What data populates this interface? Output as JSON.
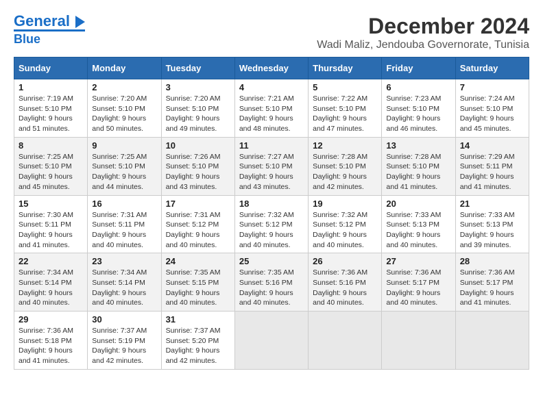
{
  "logo": {
    "text1": "General",
    "text2": "Blue"
  },
  "title": "December 2024",
  "subtitle": "Wadi Maliz, Jendouba Governorate, Tunisia",
  "days_header": [
    "Sunday",
    "Monday",
    "Tuesday",
    "Wednesday",
    "Thursday",
    "Friday",
    "Saturday"
  ],
  "weeks": [
    [
      {
        "day": "1",
        "sunrise": "Sunrise: 7:19 AM",
        "sunset": "Sunset: 5:10 PM",
        "daylight": "Daylight: 9 hours and 51 minutes."
      },
      {
        "day": "2",
        "sunrise": "Sunrise: 7:20 AM",
        "sunset": "Sunset: 5:10 PM",
        "daylight": "Daylight: 9 hours and 50 minutes."
      },
      {
        "day": "3",
        "sunrise": "Sunrise: 7:20 AM",
        "sunset": "Sunset: 5:10 PM",
        "daylight": "Daylight: 9 hours and 49 minutes."
      },
      {
        "day": "4",
        "sunrise": "Sunrise: 7:21 AM",
        "sunset": "Sunset: 5:10 PM",
        "daylight": "Daylight: 9 hours and 48 minutes."
      },
      {
        "day": "5",
        "sunrise": "Sunrise: 7:22 AM",
        "sunset": "Sunset: 5:10 PM",
        "daylight": "Daylight: 9 hours and 47 minutes."
      },
      {
        "day": "6",
        "sunrise": "Sunrise: 7:23 AM",
        "sunset": "Sunset: 5:10 PM",
        "daylight": "Daylight: 9 hours and 46 minutes."
      },
      {
        "day": "7",
        "sunrise": "Sunrise: 7:24 AM",
        "sunset": "Sunset: 5:10 PM",
        "daylight": "Daylight: 9 hours and 45 minutes."
      }
    ],
    [
      {
        "day": "8",
        "sunrise": "Sunrise: 7:25 AM",
        "sunset": "Sunset: 5:10 PM",
        "daylight": "Daylight: 9 hours and 45 minutes."
      },
      {
        "day": "9",
        "sunrise": "Sunrise: 7:25 AM",
        "sunset": "Sunset: 5:10 PM",
        "daylight": "Daylight: 9 hours and 44 minutes."
      },
      {
        "day": "10",
        "sunrise": "Sunrise: 7:26 AM",
        "sunset": "Sunset: 5:10 PM",
        "daylight": "Daylight: 9 hours and 43 minutes."
      },
      {
        "day": "11",
        "sunrise": "Sunrise: 7:27 AM",
        "sunset": "Sunset: 5:10 PM",
        "daylight": "Daylight: 9 hours and 43 minutes."
      },
      {
        "day": "12",
        "sunrise": "Sunrise: 7:28 AM",
        "sunset": "Sunset: 5:10 PM",
        "daylight": "Daylight: 9 hours and 42 minutes."
      },
      {
        "day": "13",
        "sunrise": "Sunrise: 7:28 AM",
        "sunset": "Sunset: 5:10 PM",
        "daylight": "Daylight: 9 hours and 41 minutes."
      },
      {
        "day": "14",
        "sunrise": "Sunrise: 7:29 AM",
        "sunset": "Sunset: 5:11 PM",
        "daylight": "Daylight: 9 hours and 41 minutes."
      }
    ],
    [
      {
        "day": "15",
        "sunrise": "Sunrise: 7:30 AM",
        "sunset": "Sunset: 5:11 PM",
        "daylight": "Daylight: 9 hours and 41 minutes."
      },
      {
        "day": "16",
        "sunrise": "Sunrise: 7:31 AM",
        "sunset": "Sunset: 5:11 PM",
        "daylight": "Daylight: 9 hours and 40 minutes."
      },
      {
        "day": "17",
        "sunrise": "Sunrise: 7:31 AM",
        "sunset": "Sunset: 5:12 PM",
        "daylight": "Daylight: 9 hours and 40 minutes."
      },
      {
        "day": "18",
        "sunrise": "Sunrise: 7:32 AM",
        "sunset": "Sunset: 5:12 PM",
        "daylight": "Daylight: 9 hours and 40 minutes."
      },
      {
        "day": "19",
        "sunrise": "Sunrise: 7:32 AM",
        "sunset": "Sunset: 5:12 PM",
        "daylight": "Daylight: 9 hours and 40 minutes."
      },
      {
        "day": "20",
        "sunrise": "Sunrise: 7:33 AM",
        "sunset": "Sunset: 5:13 PM",
        "daylight": "Daylight: 9 hours and 40 minutes."
      },
      {
        "day": "21",
        "sunrise": "Sunrise: 7:33 AM",
        "sunset": "Sunset: 5:13 PM",
        "daylight": "Daylight: 9 hours and 39 minutes."
      }
    ],
    [
      {
        "day": "22",
        "sunrise": "Sunrise: 7:34 AM",
        "sunset": "Sunset: 5:14 PM",
        "daylight": "Daylight: 9 hours and 40 minutes."
      },
      {
        "day": "23",
        "sunrise": "Sunrise: 7:34 AM",
        "sunset": "Sunset: 5:14 PM",
        "daylight": "Daylight: 9 hours and 40 minutes."
      },
      {
        "day": "24",
        "sunrise": "Sunrise: 7:35 AM",
        "sunset": "Sunset: 5:15 PM",
        "daylight": "Daylight: 9 hours and 40 minutes."
      },
      {
        "day": "25",
        "sunrise": "Sunrise: 7:35 AM",
        "sunset": "Sunset: 5:16 PM",
        "daylight": "Daylight: 9 hours and 40 minutes."
      },
      {
        "day": "26",
        "sunrise": "Sunrise: 7:36 AM",
        "sunset": "Sunset: 5:16 PM",
        "daylight": "Daylight: 9 hours and 40 minutes."
      },
      {
        "day": "27",
        "sunrise": "Sunrise: 7:36 AM",
        "sunset": "Sunset: 5:17 PM",
        "daylight": "Daylight: 9 hours and 40 minutes."
      },
      {
        "day": "28",
        "sunrise": "Sunrise: 7:36 AM",
        "sunset": "Sunset: 5:17 PM",
        "daylight": "Daylight: 9 hours and 41 minutes."
      }
    ],
    [
      {
        "day": "29",
        "sunrise": "Sunrise: 7:36 AM",
        "sunset": "Sunset: 5:18 PM",
        "daylight": "Daylight: 9 hours and 41 minutes."
      },
      {
        "day": "30",
        "sunrise": "Sunrise: 7:37 AM",
        "sunset": "Sunset: 5:19 PM",
        "daylight": "Daylight: 9 hours and 42 minutes."
      },
      {
        "day": "31",
        "sunrise": "Sunrise: 7:37 AM",
        "sunset": "Sunset: 5:20 PM",
        "daylight": "Daylight: 9 hours and 42 minutes."
      },
      null,
      null,
      null,
      null
    ]
  ]
}
